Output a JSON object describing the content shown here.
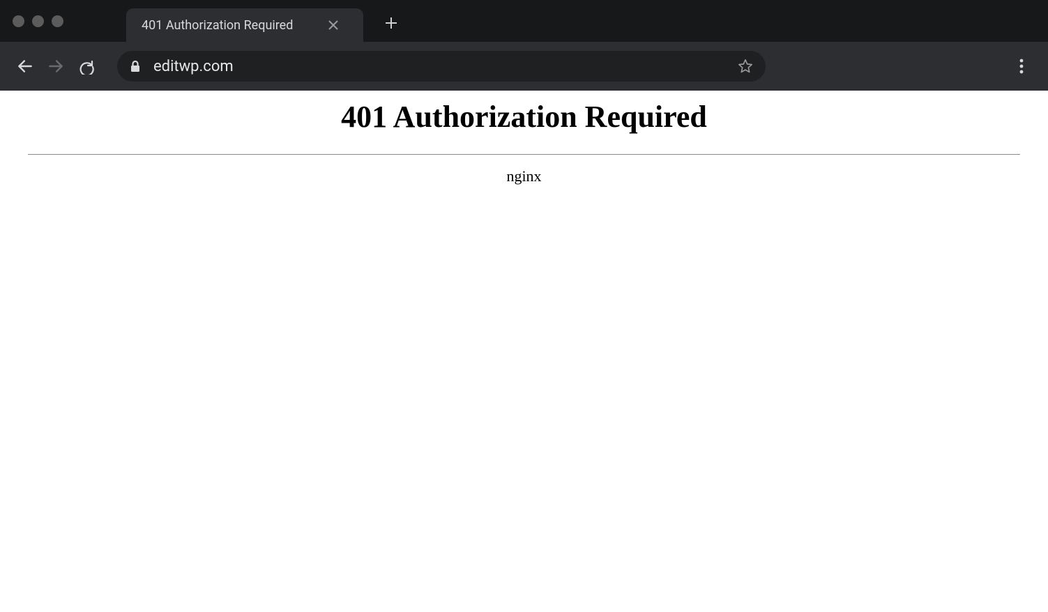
{
  "browser": {
    "tab_title": "401 Authorization Required",
    "url": "editwp.com"
  },
  "page": {
    "heading": "401 Authorization Required",
    "server": "nginx"
  }
}
